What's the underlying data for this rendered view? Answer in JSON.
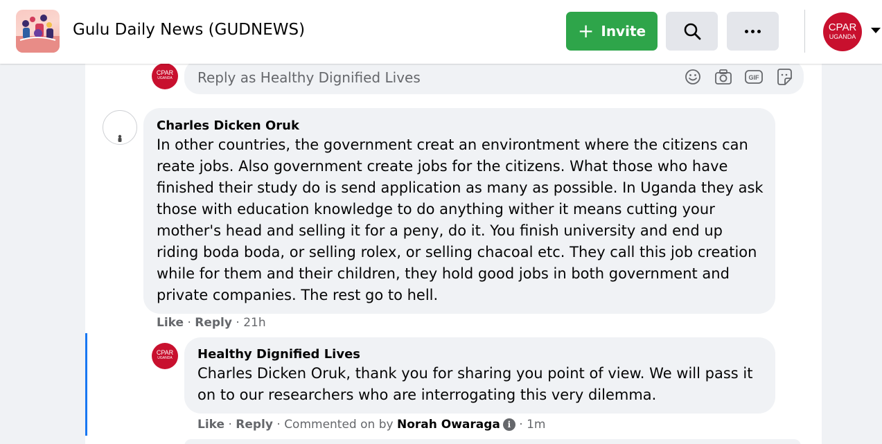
{
  "header": {
    "group_name": "Gulu Daily News (GUDNEWS)",
    "invite_label": "Invite",
    "search_icon": "search-icon",
    "more_icon": "more-horizontal-icon",
    "profile_line1": "CPAR",
    "profile_line2": "UGANDA",
    "accent": "#2ea54a"
  },
  "reply_box": {
    "avatar_line1": "CPAR",
    "avatar_line2": "UGANDA",
    "placeholder": "Reply as Healthy Dignified Lives",
    "icons": [
      "emoji-icon",
      "camera-icon",
      "gif-icon",
      "sticker-icon"
    ]
  },
  "comments": [
    {
      "author": "Charles Dicken Oruk",
      "text": "In other countries, the government creat an environtment where the citizens can reate jobs. Also government create jobs for the citizens. What those who have finished their study do is send application as many as possible. In Uganda they ask those with education knowledge to do anything wither it means cutting your mother's head and selling it for a peny, do it. You finish university and end up riding boda boda, or selling rolex, or selling chacoal etc. They call this job creation while for them and their children, they hold good jobs in both government and private companies. The rest go to hell.",
      "like": "Like",
      "reply": "Reply",
      "time": "21h"
    },
    {
      "author": "Healthy Dignified Lives",
      "avatar_line1": "CPAR",
      "avatar_line2": "UGANDA",
      "text": "Charles Dicken Oruk, thank you for sharing you point of view. We will pass it on to our researchers who are interrogating this very dilemma.",
      "like": "Like",
      "reply": "Reply",
      "commented_on_by": "Commented on by",
      "commenter": "Norah Owaraga",
      "info_icon": "i",
      "time": "1m"
    }
  ],
  "colors": {
    "brand_red": "#c8102e",
    "thread_line": "#1877f2"
  }
}
